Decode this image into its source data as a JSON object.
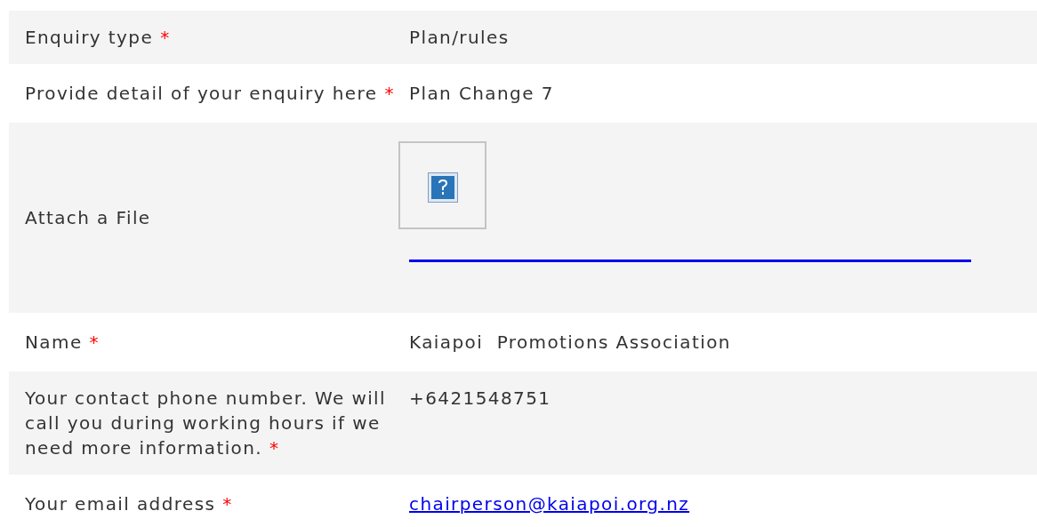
{
  "rows": [
    {
      "label": "Enquiry type",
      "required_mark": "*",
      "kind": "text",
      "value": "Plan/rules"
    },
    {
      "label": "Provide detail of your enquiry here",
      "required_mark": "*",
      "kind": "text",
      "value": "Plan Change 7"
    },
    {
      "label": "Attach a File",
      "kind": "file"
    },
    {
      "label": "Name",
      "required_mark": "*",
      "kind": "text",
      "value": "Kaiapoi  Promotions Association"
    },
    {
      "label": "Your contact phone number. We will call you during working hours if we need more information.",
      "required_mark": "*",
      "kind": "text",
      "value": "+6421548751"
    },
    {
      "label": "Your email address",
      "required_mark": "*",
      "kind": "link",
      "value": "chairperson@kaiapoi.org.nz"
    }
  ]
}
